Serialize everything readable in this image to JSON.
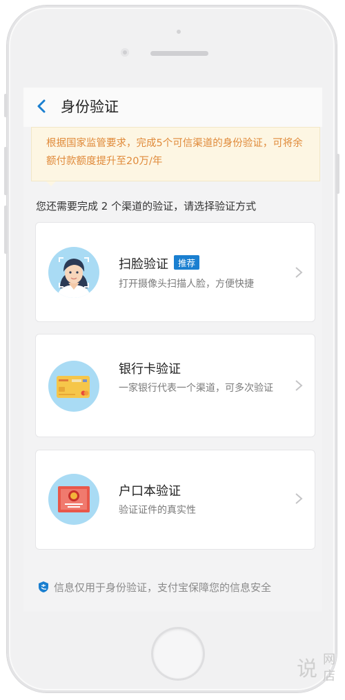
{
  "nav": {
    "title": "身份验证"
  },
  "notice": {
    "text": "根据国家监管要求，完成5个可信渠道的身份验证，可将余额付款额度提升至20万/年"
  },
  "instruction": "您还需要完成 2 个渠道的验证，请选择验证方式",
  "options": [
    {
      "title": "扫脸验证",
      "badge": "推荐",
      "desc": "打开摄像头扫描人脸，方便快捷",
      "icon": "face-scan-icon"
    },
    {
      "title": "银行卡验证",
      "desc": "一家银行代表一个渠道，可多次验证",
      "icon": "bank-card-icon"
    },
    {
      "title": "户口本验证",
      "desc": "验证证件的真实性",
      "icon": "household-register-icon"
    }
  ],
  "footer": {
    "text": "信息仅用于身份验证，支付宝保障您的信息安全",
    "icon": "alipay-shield-icon"
  },
  "watermark": {
    "char1": "说",
    "char2": "网店"
  },
  "colors": {
    "accent": "#1a7fd0",
    "notice_text": "#e08a3a",
    "notice_bg": "#fdf6e3",
    "icon_bg": "#a9dbf4"
  }
}
